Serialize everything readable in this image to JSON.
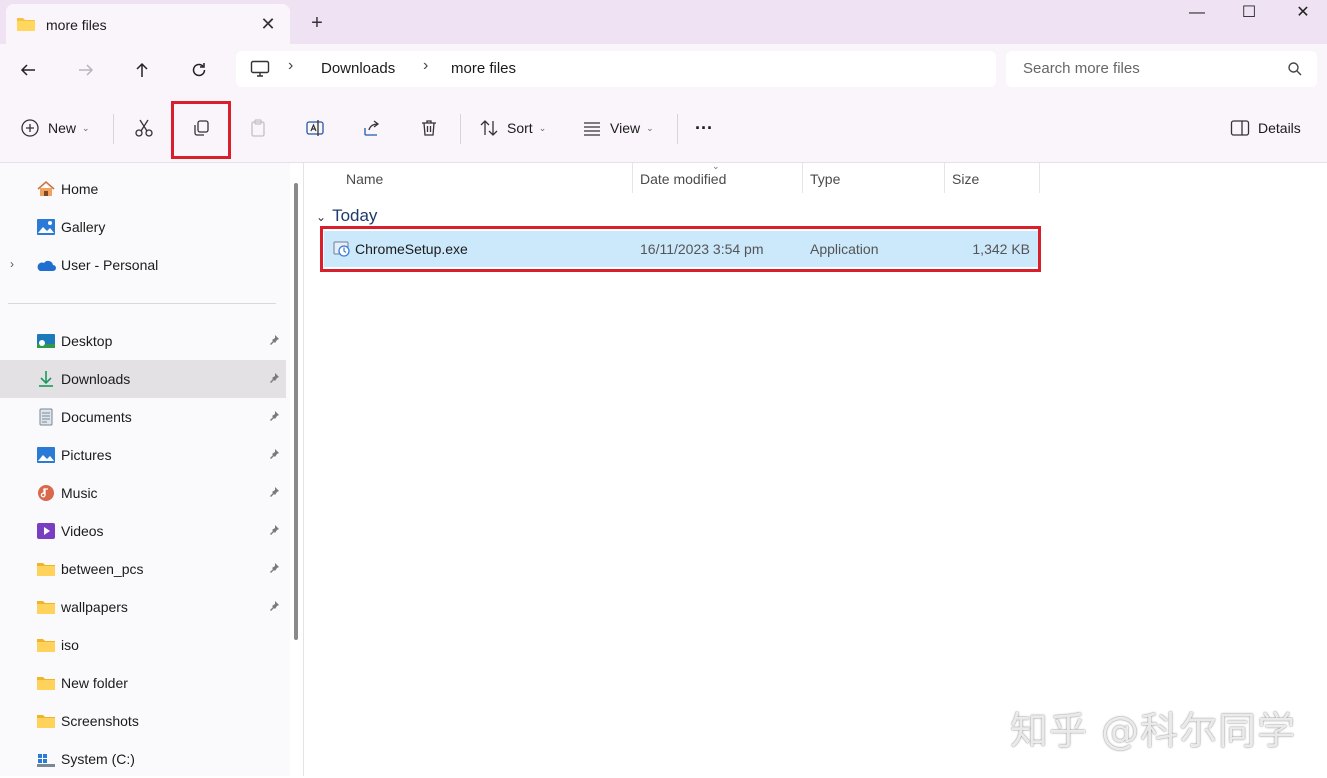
{
  "tab": {
    "title": "more files",
    "close": "✕",
    "add": "+"
  },
  "window": {
    "minimize": "—",
    "maximize": "☐",
    "close": "✕"
  },
  "nav": {
    "breadcrumb": [
      "Downloads",
      "more files"
    ],
    "search_placeholder": "Search more files"
  },
  "toolbar": {
    "new_label": "New",
    "sort_label": "Sort",
    "view_label": "View",
    "more_label": "···",
    "details_label": "Details",
    "highlight_color": "#d8202c"
  },
  "sidebar": {
    "top": [
      {
        "label": "Home",
        "icon": "home-icon"
      },
      {
        "label": "Gallery",
        "icon": "gallery-icon"
      },
      {
        "label": "User - Personal",
        "icon": "onedrive-icon"
      }
    ],
    "pinned": [
      {
        "label": "Desktop",
        "icon": "desktop-icon",
        "pinned": true
      },
      {
        "label": "Downloads",
        "icon": "download-icon",
        "pinned": true,
        "selected": true
      },
      {
        "label": "Documents",
        "icon": "document-icon",
        "pinned": true
      },
      {
        "label": "Pictures",
        "icon": "pictures-icon",
        "pinned": true
      },
      {
        "label": "Music",
        "icon": "music-icon",
        "pinned": true
      },
      {
        "label": "Videos",
        "icon": "videos-icon",
        "pinned": true
      },
      {
        "label": "between_pcs",
        "icon": "folder-icon",
        "pinned": true
      },
      {
        "label": "wallpapers",
        "icon": "folder-icon",
        "pinned": true
      },
      {
        "label": "iso",
        "icon": "folder-icon",
        "pinned": false
      },
      {
        "label": "New folder",
        "icon": "folder-icon",
        "pinned": false
      },
      {
        "label": "Screenshots",
        "icon": "folder-icon",
        "pinned": false
      },
      {
        "label": "System (C:)",
        "icon": "drive-icon",
        "pinned": false
      }
    ]
  },
  "columns": {
    "name": "Name",
    "date": "Date modified",
    "type": "Type",
    "size": "Size"
  },
  "group": {
    "label": "Today"
  },
  "file": {
    "name": "ChromeSetup.exe",
    "date": "16/11/2023 3:54 pm",
    "type": "Application",
    "size": "1,342 KB"
  },
  "watermark": "知乎 @科尔同学"
}
